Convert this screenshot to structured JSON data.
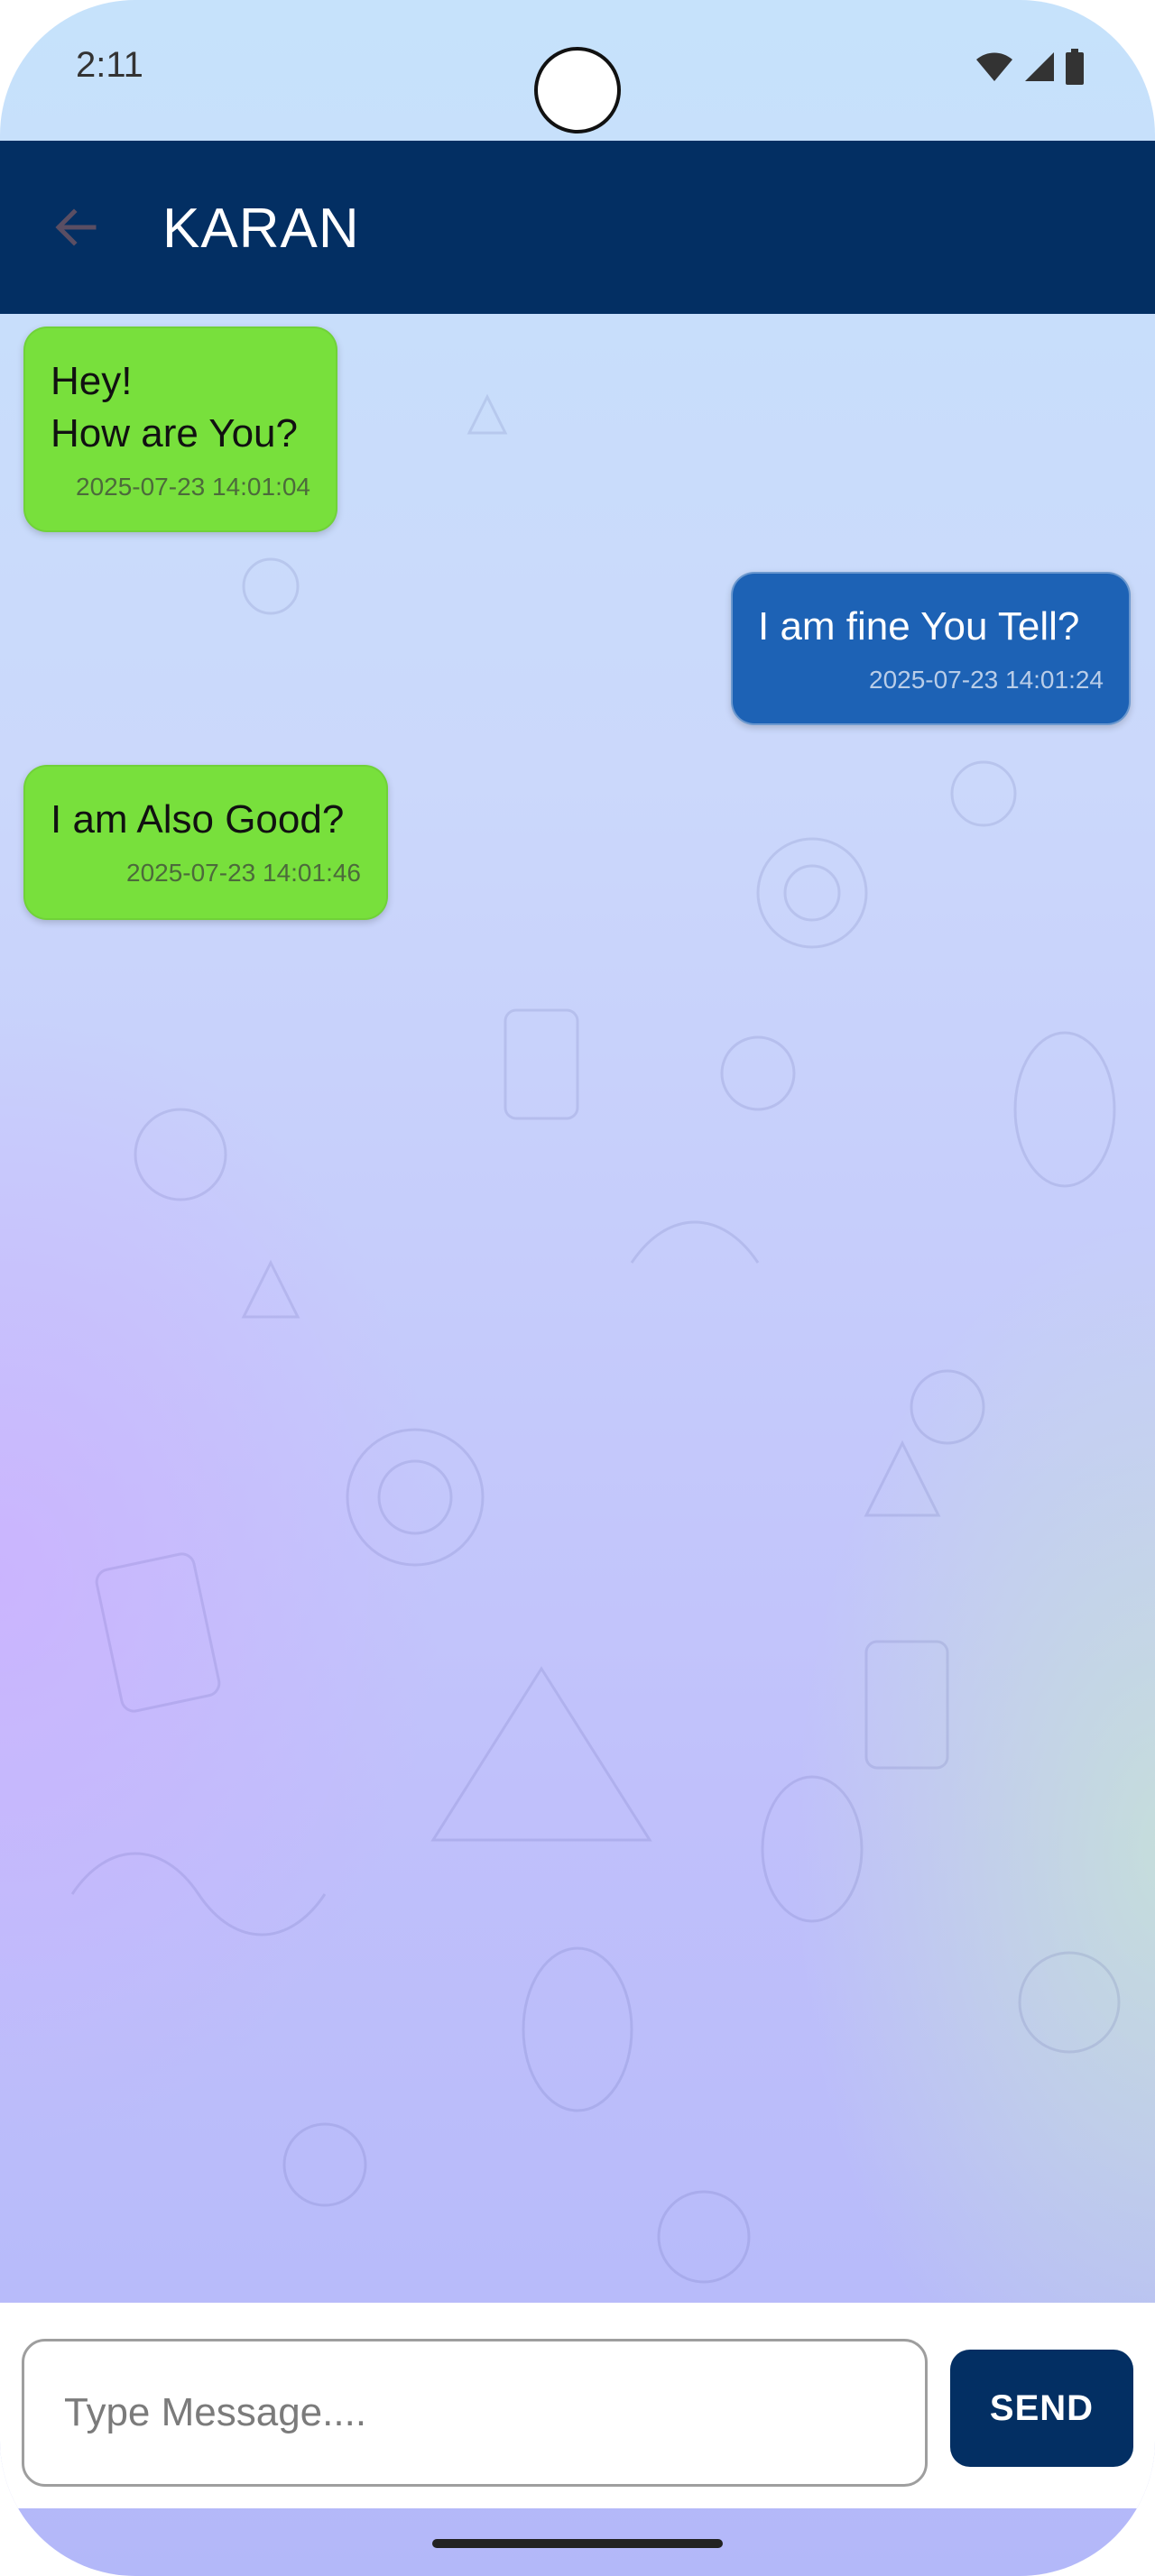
{
  "status_bar": {
    "time": "2:11",
    "icons": [
      "wifi-icon",
      "signal-icon",
      "battery-icon"
    ]
  },
  "app_bar": {
    "back_icon": "arrow-back-icon",
    "title": "KARAN"
  },
  "messages": [
    {
      "direction": "incoming",
      "text": "Hey!\nHow are You?",
      "timestamp": "2025-07-23 14:01:04"
    },
    {
      "direction": "outgoing",
      "text": "I am fine You Tell?",
      "timestamp": "2025-07-23 14:01:24"
    },
    {
      "direction": "incoming",
      "text": "I am Also Good?",
      "timestamp": "2025-07-23 14:01:46"
    }
  ],
  "composer": {
    "placeholder": "Type Message....",
    "value": "",
    "send_label": "SEND"
  },
  "colors": {
    "app_bar": "#032f63",
    "incoming_bubble": "#78e03c",
    "outgoing_bubble": "#1d62b5",
    "send_button": "#032f63"
  }
}
